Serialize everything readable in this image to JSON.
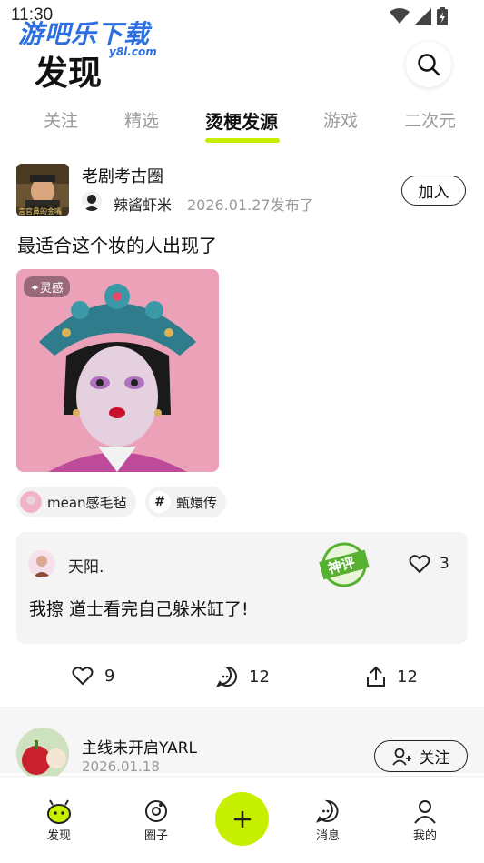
{
  "status": {
    "time": "11:30"
  },
  "watermark": {
    "brand": "游吧乐下载",
    "domain": "y8l.com"
  },
  "header": {
    "title": "发现"
  },
  "tabs": [
    {
      "label": "关注"
    },
    {
      "label": "精选"
    },
    {
      "label": "烫梗发源"
    },
    {
      "label": "游戏"
    },
    {
      "label": "二次元"
    }
  ],
  "post": {
    "circle_name": "老剧考古圈",
    "author": "辣酱虾米",
    "date": "2026.01.27发布了",
    "join_label": "加入",
    "cover_caption": "言官鼻的金嘴",
    "text": "最适合这个妆的人出现了",
    "image_badge": "灵感",
    "tags": [
      {
        "label": "mean感毛毡",
        "icon": "avatar"
      },
      {
        "label": "甄嬛传",
        "icon": "hashtag-icon"
      }
    ],
    "top_comment": {
      "user": "天阳.",
      "text": "我擦 道士看完自己躲米缸了!",
      "likes": "3",
      "stamp": "神评"
    },
    "actions": {
      "likes": "9",
      "comments": "12",
      "shares": "12"
    }
  },
  "next_post": {
    "user": "主线未开启YARL",
    "date": "2026.01.18",
    "follow_label": "关注"
  },
  "bottom_nav": [
    {
      "label": "发现",
      "icon": "discover-icon"
    },
    {
      "label": "圈子",
      "icon": "circle-icon"
    },
    {
      "label": "消息",
      "icon": "message-icon"
    },
    {
      "label": "我的",
      "icon": "profile-icon"
    }
  ],
  "colors": {
    "accent": "#c6f000",
    "text": "#111111",
    "muted": "#999999"
  }
}
